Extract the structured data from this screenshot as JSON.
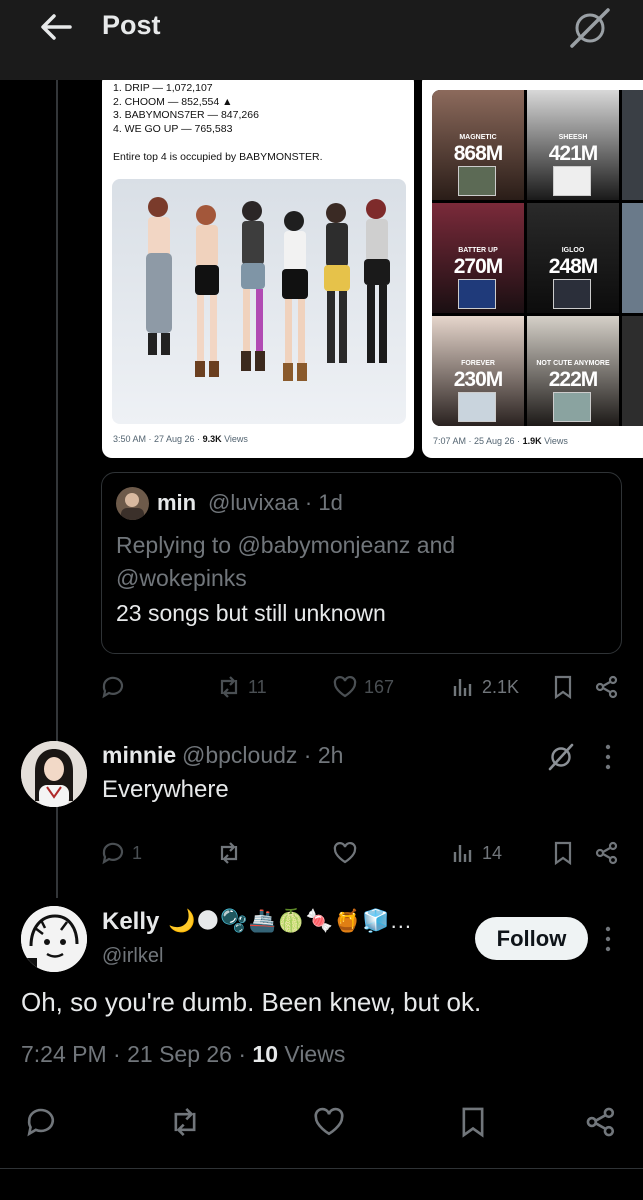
{
  "header": {
    "title": "Post"
  },
  "left_card": {
    "lines": [
      "1. DRIP — 1,072,107",
      "2. CHOOM — 852,554 ▲",
      "3. BABYMONS7ER — 847,266",
      "4. WE GO UP — 765,583"
    ],
    "note": "Entire top 4 is occupied by BABYMONSTER.",
    "time": "3:50 AM · 27 Aug 26 · ",
    "views_count": "9.3K",
    "views_label": " Views"
  },
  "right_card": {
    "tiles": [
      {
        "label": "MAGNETIC",
        "value": "868M"
      },
      {
        "label": "SHEESH",
        "value": "421M"
      },
      {
        "label": "BATTER UP",
        "value": "270M"
      },
      {
        "label": "IGLOO",
        "value": "248M"
      },
      {
        "label": "FOREVER",
        "value": "230M"
      },
      {
        "label": "NOT CUTE ANYMORE",
        "value": "222M"
      }
    ],
    "time": "7:07 AM · 25 Aug 26 · ",
    "views_count": "1.9K",
    "views_label": " Views"
  },
  "quote": {
    "name": "min",
    "handle": "@luvixaa · 1d",
    "replying": "Replying to @babymonjeanz and @wokepinks",
    "text": "23 songs but still unknown",
    "stats": {
      "retweets": "11",
      "likes": "167",
      "views": "2.1K"
    }
  },
  "reply": {
    "name": "minnie",
    "handle": "@bpcloudz · 2h",
    "text": "Everywhere",
    "stats": {
      "replies": "1",
      "views": "14"
    }
  },
  "post": {
    "name": "Kelly",
    "emoji": "🌙🌑🫧🚢🍈🍬🍯🧊...",
    "handle": "@irlkel",
    "follow_label": "Follow",
    "text": "Oh, so you're dumb. Been knew, but ok.",
    "time": "7:24 PM · 21 Sep 26 · ",
    "views_count": "10",
    "views_label": " Views"
  },
  "icons": [
    "back-arrow-icon",
    "grok-icon",
    "reply-icon",
    "retweet-icon",
    "like-icon",
    "views-icon",
    "bookmark-icon",
    "share-icon",
    "more-icon"
  ]
}
